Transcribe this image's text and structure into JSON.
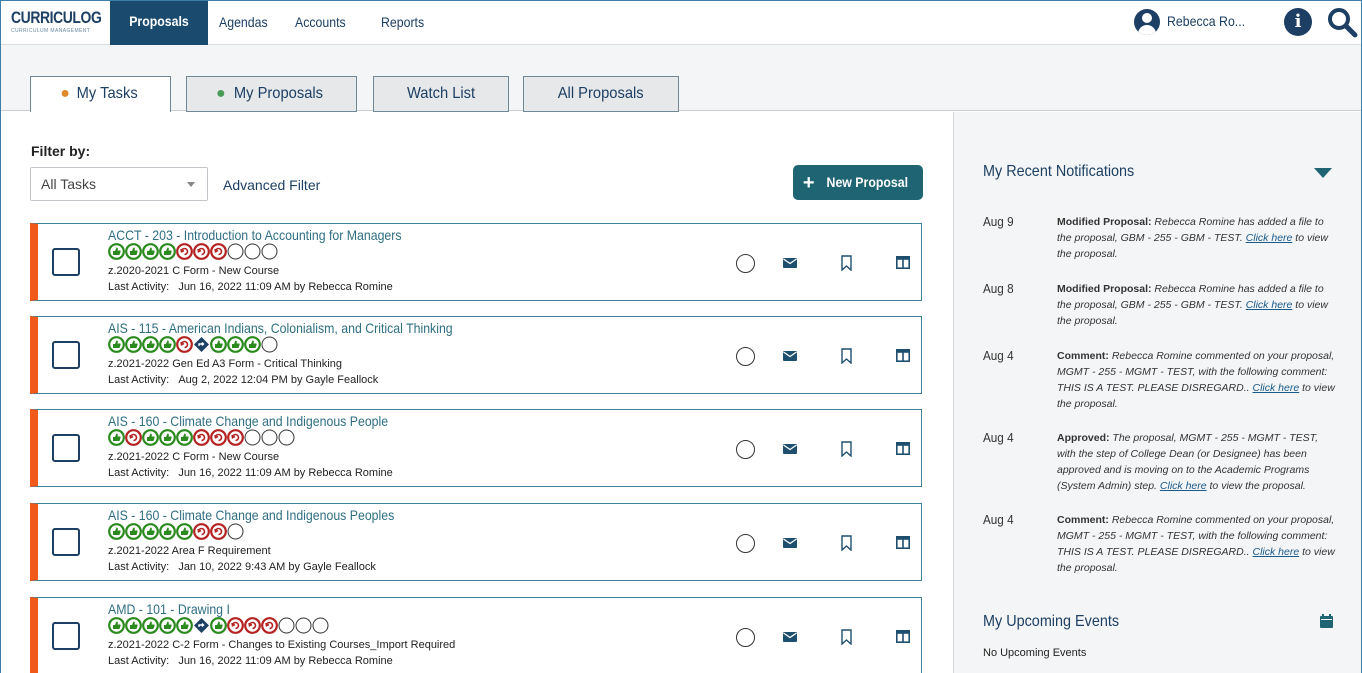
{
  "app": {
    "logo_text": "CURRICULOG",
    "logo_sub": "CURRICULUM MANAGEMENT"
  },
  "nav": {
    "items": [
      {
        "label": "Proposals",
        "active": true
      },
      {
        "label": "Agendas"
      },
      {
        "label": "Accounts"
      },
      {
        "label": "Reports"
      }
    ],
    "user_name": "Rebecca Ro...",
    "icons": [
      "user-icon",
      "info-icon",
      "search-icon"
    ]
  },
  "tabs": [
    {
      "label": "My Tasks",
      "dot_color": "#e0892c",
      "active": true
    },
    {
      "label": "My Proposals",
      "dot_color": "#4a9a5a"
    },
    {
      "label": "Watch List"
    },
    {
      "label": "All Proposals"
    }
  ],
  "filter": {
    "label": "Filter by:",
    "selected": "All Tasks",
    "advanced": "Advanced Filter",
    "new_proposal": "New Proposal"
  },
  "colors": {
    "accent": "#1f6472",
    "card_border": "#f25a1c",
    "nav_active": "#1a4a6e",
    "step_green": "#2b8a1e",
    "step_red": "#b52222",
    "step_blue": "#1c3f63"
  },
  "proposals": [
    {
      "title": "ACCT - 203 - Introduction to Accounting for Managers",
      "steps": [
        "green",
        "green",
        "green",
        "green",
        "red",
        "red",
        "red",
        "empty",
        "empty",
        "empty"
      ],
      "form": "z.2020-2021 C Form - New Course",
      "activity_label": "Last Activity:",
      "activity": "Jun 16, 2022 11:09 AM by Rebecca Romine"
    },
    {
      "title": "AIS - 115 - American Indians, Colonialism, and Critical Thinking",
      "steps": [
        "green",
        "green",
        "green",
        "green",
        "red",
        "blue",
        "green",
        "green",
        "green",
        "empty"
      ],
      "form": "z.2021-2022 Gen Ed A3 Form - Critical Thinking",
      "activity_label": "Last Activity:",
      "activity": "Aug 2, 2022 12:04 PM by Gayle Feallock"
    },
    {
      "title": "AIS - 160 - Climate Change and Indigenous People",
      "steps": [
        "green",
        "red",
        "green",
        "green",
        "green",
        "red",
        "red",
        "red",
        "empty",
        "empty",
        "empty"
      ],
      "form": "z.2021-2022 C Form - New Course",
      "activity_label": "Last Activity:",
      "activity": "Jun 16, 2022 11:09 AM by Rebecca Romine"
    },
    {
      "title": "AIS - 160 - Climate Change and Indigenous Peoples",
      "steps": [
        "green",
        "green",
        "green",
        "green",
        "green",
        "red",
        "red",
        "empty"
      ],
      "form": "z.2021-2022 Area F Requirement",
      "activity_label": "Last Activity:",
      "activity": "Jan 10, 2022 9:43 AM by Gayle Feallock"
    },
    {
      "title": "AMD - 101 - Drawing I",
      "steps": [
        "green",
        "green",
        "green",
        "green",
        "green",
        "blue",
        "green",
        "red",
        "red",
        "red",
        "empty",
        "empty",
        "empty"
      ],
      "form": "z.2021-2022 C-2 Form - Changes to Existing Courses_Import Required",
      "activity_label": "Last Activity:",
      "activity": "Jun 16, 2022 11:09 AM by Rebecca Romine"
    }
  ],
  "notifications": {
    "title": "My Recent Notifications",
    "items": [
      {
        "date": "Aug 9",
        "kind": "Modified Proposal:",
        "text": "Rebecca Romine has added a file to the proposal, GBM - 255 - GBM - TEST.",
        "link": "Click here",
        "tail": "to view the proposal."
      },
      {
        "date": "Aug 8",
        "kind": "Modified Proposal:",
        "text": "Rebecca Romine has added a file to the proposal, GBM - 255 - GBM - TEST.",
        "link": "Click here",
        "tail": "to view the proposal."
      },
      {
        "date": "Aug 4",
        "kind": "Comment:",
        "text": "Rebecca Romine commented on your proposal, MGMT - 255 - MGMT - TEST, with the following comment: THIS IS A TEST. PLEASE DISREGARD..",
        "link": "Click here",
        "tail": "to view the proposal."
      },
      {
        "date": "Aug 4",
        "kind": "Approved:",
        "text": "The proposal, MGMT - 255 - MGMT - TEST, with the step of College Dean (or Designee) has been approved and is moving on to the Academic Programs (System Admin) step.",
        "link": "Click here",
        "tail": "to view the proposal."
      },
      {
        "date": "Aug 4",
        "kind": "Comment:",
        "text": "Rebecca Romine commented on your proposal, MGMT - 255 - MGMT - TEST, with the following comment: THIS IS A TEST. PLEASE DISREGARD..",
        "link": "Click here",
        "tail": "to view the proposal."
      }
    ]
  },
  "events": {
    "title": "My Upcoming Events",
    "empty": "No Upcoming Events"
  }
}
